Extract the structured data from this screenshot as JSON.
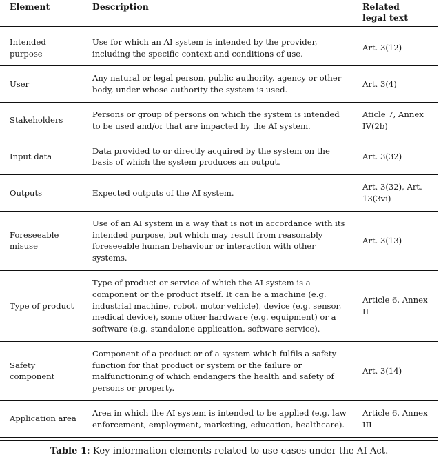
{
  "table": {
    "columns": [
      {
        "key": "element",
        "header": "Element"
      },
      {
        "key": "description",
        "header": "Description"
      },
      {
        "key": "legal",
        "header_line1": "Related",
        "header_line2": "legal text"
      }
    ],
    "rows": [
      {
        "element": "Intended purpose",
        "description": "Use for which an AI system is intended by the provider, including the specific context and conditions of use.",
        "legal": "Art. 3(12)"
      },
      {
        "element": "User",
        "description": "Any natural or legal person, public authority, agency or other body, under whose authority the system is used.",
        "legal": "Art. 3(4)"
      },
      {
        "element": "Stakeholders",
        "description": "Persons or group of persons on which the system is intended to be used and/or that are impacted by the AI system.",
        "legal": "Aticle 7, Annex IV(2b)"
      },
      {
        "element": "Input data",
        "description": "Data provided to or directly acquired by the system on the basis of which the system produces an output.",
        "legal": "Art. 3(32)"
      },
      {
        "element": "Outputs",
        "description": "Expected outputs of the AI system.",
        "legal": "Art. 3(32), Art. 13(3vi)"
      },
      {
        "element": "Foreseeable misuse",
        "description": "Use of an AI system in a way that is not in accordance with its intended purpose, but which may result from reasonably foreseeable human behaviour or interaction with other systems.",
        "legal": "Art. 3(13)"
      },
      {
        "element": "Type of product",
        "description": "Type of product or service of which the AI system is a component or the product itself. It can be a machine (e.g. industrial machine, robot, motor vehicle), device (e.g. sensor, medical device), some other hardware (e.g. equipment) or a software (e.g. standalone application, software service).",
        "legal": "Article 6, Annex II"
      },
      {
        "element": "Safety component",
        "description": "Component of a product or of a system which fulfils a safety function for that product or system or the failure or malfunctioning of which endangers the health and safety of persons or property.",
        "legal": "Art. 3(14)"
      },
      {
        "element": "Application area",
        "description": "Area in which the AI system is intended to be applied (e.g. law enforcement, employment, marketing, education, healthcare).",
        "legal": "Article 6, Annex III"
      }
    ]
  },
  "caption": {
    "label": "Table 1",
    "separator": ": ",
    "text": "Key information elements related to use cases under the AI Act."
  }
}
